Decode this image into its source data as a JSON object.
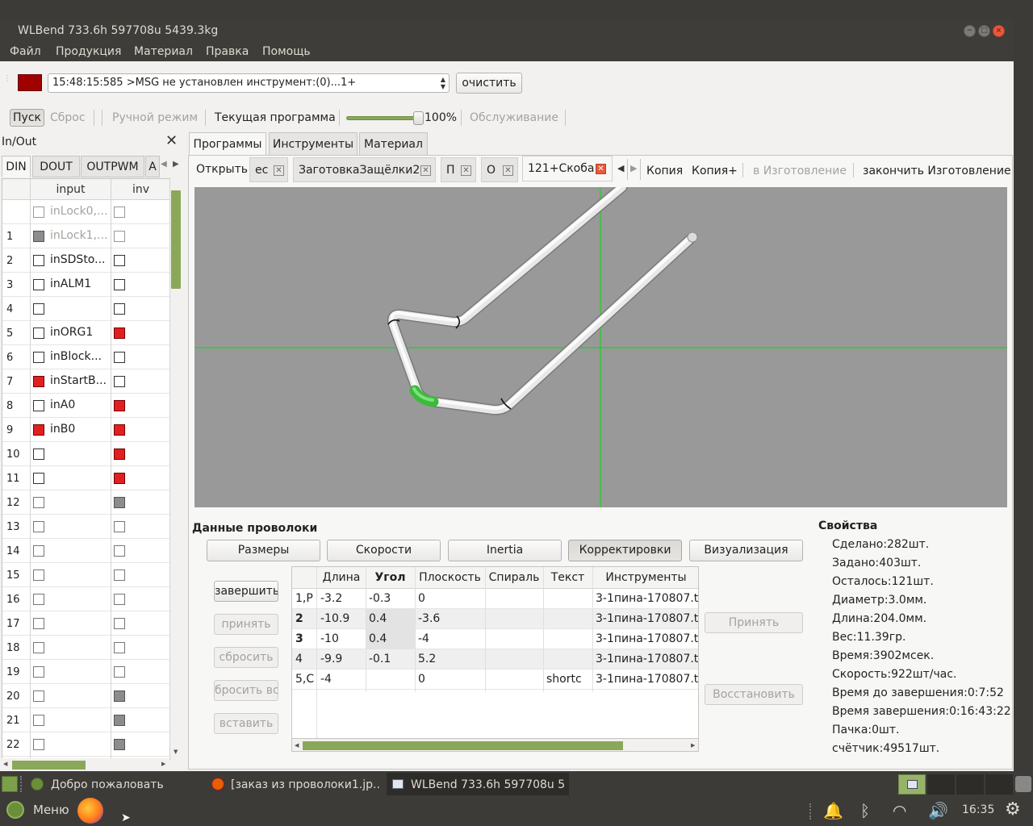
{
  "window": {
    "title": "WLBend 733.6h 597708u 5439.3kg"
  },
  "menubar": [
    "Файл",
    "Продукция",
    "Материал",
    "Правка",
    "Помощь"
  ],
  "log": {
    "message": "15:48:15:585 >MSG не установлен инструмент:(0)...1+",
    "clear_label": "очистить",
    "status_color": "#a00000"
  },
  "controls": {
    "start": "Пуск",
    "reset": "Сброс",
    "manual": "Ручной режим",
    "current": "Текущая программа",
    "speed_pct": "100%",
    "speed_value": 1.0,
    "service": "Обслуживание"
  },
  "inout": {
    "title": "In/Out",
    "tabs": [
      "DIN",
      "DOUT",
      "OUTPWM",
      "A"
    ],
    "headers": [
      "input",
      "inv"
    ],
    "rows": [
      {
        "num": "",
        "label": "inLock0,...",
        "in": "dim",
        "inv": "dim",
        "dis": true
      },
      {
        "num": "1",
        "label": "inLock1,...",
        "in": "gray",
        "inv": "dim",
        "dis": true
      },
      {
        "num": "2",
        "label": "inSDSto...",
        "in": "off",
        "inv": "off"
      },
      {
        "num": "3",
        "label": "inALM1",
        "in": "off",
        "inv": "off"
      },
      {
        "num": "4",
        "label": "",
        "in": "off",
        "inv": "off"
      },
      {
        "num": "5",
        "label": "inORG1",
        "in": "off",
        "inv": "red"
      },
      {
        "num": "6",
        "label": "inBlock...",
        "in": "off",
        "inv": "off"
      },
      {
        "num": "7",
        "label": "inStartB...",
        "in": "red",
        "inv": "off"
      },
      {
        "num": "8",
        "label": "inA0",
        "in": "off",
        "inv": "red"
      },
      {
        "num": "9",
        "label": "inB0",
        "in": "red",
        "inv": "red"
      },
      {
        "num": "10",
        "label": "",
        "in": "off",
        "inv": "red"
      },
      {
        "num": "11",
        "label": "",
        "in": "off",
        "inv": "red"
      },
      {
        "num": "12",
        "label": "",
        "in": "lite",
        "inv": "gray"
      },
      {
        "num": "13",
        "label": "",
        "in": "lite",
        "inv": "lite"
      },
      {
        "num": "14",
        "label": "",
        "in": "lite",
        "inv": "lite"
      },
      {
        "num": "15",
        "label": "",
        "in": "lite",
        "inv": "lite"
      },
      {
        "num": "16",
        "label": "",
        "in": "lite",
        "inv": "lite"
      },
      {
        "num": "17",
        "label": "",
        "in": "lite",
        "inv": "lite"
      },
      {
        "num": "18",
        "label": "",
        "in": "lite",
        "inv": "lite"
      },
      {
        "num": "19",
        "label": "",
        "in": "lite",
        "inv": "lite"
      },
      {
        "num": "20",
        "label": "",
        "in": "lite",
        "inv": "gray"
      },
      {
        "num": "21",
        "label": "",
        "in": "lite",
        "inv": "gray"
      },
      {
        "num": "22",
        "label": "",
        "in": "lite",
        "inv": "gray"
      }
    ]
  },
  "main_tabs": [
    "Программы",
    "Инструменты",
    "Материал"
  ],
  "program_tabs": {
    "open": "Открыть",
    "tabs": [
      "ес",
      "ЗаготовкаЗащёлки2",
      "П",
      "О",
      "121+Скоба"
    ],
    "actions": {
      "copy": "Копия",
      "copy_plus": "Копия+",
      "to_production": "в Изготовление",
      "finish_production": "закончить Изготовление"
    }
  },
  "wire": {
    "title": "Данные проволоки",
    "tabs": [
      "Размеры",
      "Скорости",
      "Inertia",
      "Корректировки",
      "Визуализация"
    ],
    "side_buttons": [
      "завершить",
      "принять",
      "сбросить",
      "бросить вс",
      "вставить"
    ],
    "columns": [
      "Длина",
      "Угол",
      "Плоскость",
      "Спираль",
      "Текст",
      "Инструменты"
    ],
    "rows": [
      {
        "idx": "1,Р",
        "len": "-3.2",
        "ang": "-0.3",
        "plane": "0",
        "spiral": "",
        "text": "",
        "tool": "3-1пина-170807.tol"
      },
      {
        "idx": "2",
        "len": "-10.9",
        "ang": "0.4",
        "plane": "-3.6",
        "spiral": "",
        "text": "",
        "tool": "3-1пина-170807.tol"
      },
      {
        "idx": "3",
        "len": "-10",
        "ang": "0.4",
        "plane": "-4",
        "spiral": "",
        "text": "",
        "tool": "3-1пина-170807.tol"
      },
      {
        "idx": "4",
        "len": "-9.9",
        "ang": "-0.1",
        "plane": "5.2",
        "spiral": "",
        "text": "",
        "tool": "3-1пина-170807.tol"
      },
      {
        "idx": "5,С",
        "len": "-4",
        "ang": "",
        "plane": "0",
        "spiral": "",
        "text": "shortc",
        "tool": "3-1пина-170807.tol"
      }
    ],
    "accept": "Принять",
    "restore": "Восстановить"
  },
  "properties": {
    "title": "Свойства",
    "items": [
      "Сделано:282шт.",
      "Задано:403шт.",
      "Осталось:121шт.",
      "Диаметр:3.0мм.",
      "Длина:204.0мм.",
      "Вес:11.39гр.",
      "Время:3902мсек.",
      "Скорость:922шт/час.",
      "Время до завершения:0:7:52",
      "Время завершения:0:16:43:22",
      "Пачка:0шт.",
      "счётчик:49517шт."
    ]
  },
  "taskbar": {
    "items": [
      "Добро пожаловать",
      "[заказ из проволоки1.jp...",
      "WLBend 733.6h 597708u 5..."
    ],
    "menu": "Меню",
    "clock": "16:35"
  }
}
